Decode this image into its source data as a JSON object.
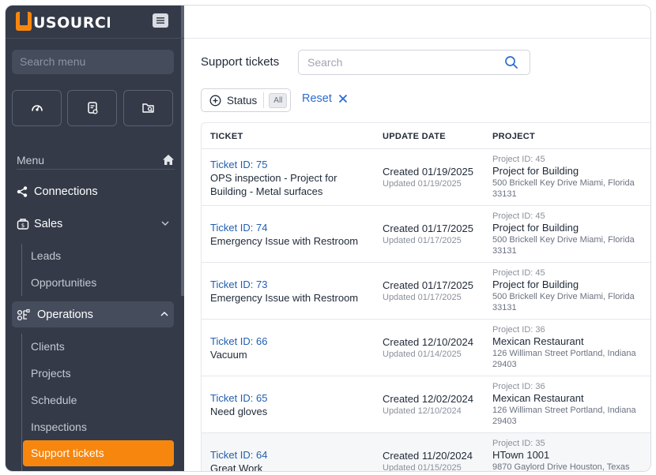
{
  "brand": {
    "logo_text": "USOURCE",
    "accent": "#f7860f"
  },
  "sidebar": {
    "search_placeholder": "Search menu",
    "quick_actions": [
      {
        "icon": "dashboard-gauge-icon"
      },
      {
        "icon": "document-settings-icon"
      },
      {
        "icon": "folder-search-icon"
      }
    ],
    "menu_label": "Menu",
    "items": {
      "connections": "Connections",
      "sales": "Sales",
      "leads": "Leads",
      "opportunities": "Opportunities",
      "operations": "Operations",
      "clients": "Clients",
      "projects": "Projects",
      "schedule": "Schedule",
      "inspections": "Inspections",
      "support_tickets": "Support tickets"
    }
  },
  "main": {
    "title": "Support tickets",
    "search_placeholder": "Search",
    "filter": {
      "label": "Status",
      "badge": "All"
    },
    "reset_label": "Reset",
    "columns": {
      "ticket": "TICKET",
      "update_date": "UPDATE DATE",
      "project": "PROJECT"
    },
    "rows": [
      {
        "ticket_id": "Ticket ID: 75",
        "desc": "OPS inspection - Project for Building - Metal surfaces",
        "created": "Created 01/19/2025",
        "updated": "Updated 01/19/2025",
        "project_id": "Project ID: 45",
        "project_name": "Project for Building",
        "address": "500 Brickell Key Drive Miami, Florida 33131"
      },
      {
        "ticket_id": "Ticket ID: 74",
        "desc": "Emergency Issue with Restroom",
        "created": "Created 01/17/2025",
        "updated": "Updated 01/17/2025",
        "project_id": "Project ID: 45",
        "project_name": "Project for Building",
        "address": "500 Brickell Key Drive Miami, Florida 33131"
      },
      {
        "ticket_id": "Ticket ID: 73",
        "desc": "Emergency Issue with Restroom",
        "created": "Created 01/17/2025",
        "updated": "Updated 01/17/2025",
        "project_id": "Project ID: 45",
        "project_name": "Project for Building",
        "address": "500 Brickell Key Drive Miami, Florida 33131"
      },
      {
        "ticket_id": "Ticket ID: 66",
        "desc": "Vacuum",
        "created": "Created 12/10/2024",
        "updated": "Updated 01/14/2025",
        "project_id": "Project ID: 36",
        "project_name": "Mexican Restaurant",
        "address": "126 Williman Street Portland, Indiana 29403"
      },
      {
        "ticket_id": "Ticket ID: 65",
        "desc": "Need gloves",
        "created": "Created 12/02/2024",
        "updated": "Updated 12/10/2024",
        "project_id": "Project ID: 36",
        "project_name": "Mexican Restaurant",
        "address": "126 Williman Street Portland, Indiana 29403"
      },
      {
        "ticket_id": "Ticket ID: 64",
        "desc": "Great Work",
        "created": "Created 11/20/2024",
        "updated": "Updated 01/15/2025",
        "project_id": "Project ID: 35",
        "project_name": "HTown 1001",
        "address": "9870 Gaylord Drive Houston, Texas"
      }
    ]
  }
}
